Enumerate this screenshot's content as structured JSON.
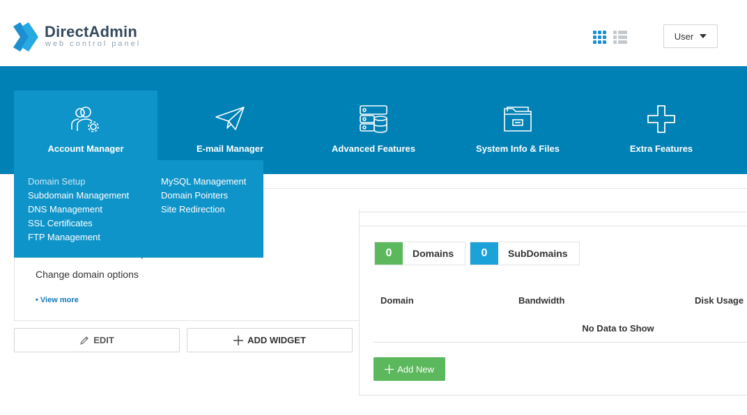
{
  "brand": {
    "name": "DirectAdmin",
    "tagline": "web control panel",
    "primary_color": "#0081b5",
    "active_color": "#0f94c9"
  },
  "header": {
    "user_label": "User",
    "views": [
      "grid-view-icon",
      "list-view-icon"
    ]
  },
  "nav": {
    "items": [
      {
        "label": "Account Manager",
        "icon": "users-gear-icon",
        "active": true
      },
      {
        "label": "E-mail Manager",
        "icon": "paper-plane-icon"
      },
      {
        "label": "Advanced Features",
        "icon": "server-icon"
      },
      {
        "label": "System Info & Files",
        "icon": "folder-icon"
      },
      {
        "label": "Extra Features",
        "icon": "plus-icon"
      }
    ],
    "dropdown": {
      "col1": [
        "Domain Setup",
        "Subdomain Management",
        "DNS Management",
        "SSL Certificates",
        "FTP Management"
      ],
      "col2": [
        "MySQL Management",
        "Domain Pointers",
        "Site Redirection"
      ]
    }
  },
  "widget": {
    "title_fragment": "p",
    "description": "Change domain options",
    "view_more": "• View more"
  },
  "actions": {
    "edit": "EDIT",
    "add_widget": "ADD WIDGET"
  },
  "stats": {
    "domains": {
      "count": "0",
      "label": "Domains",
      "color": "#5cb85c"
    },
    "subdomains": {
      "count": "0",
      "label": "SubDomains",
      "color": "#1ba2d8"
    }
  },
  "table": {
    "columns": [
      "Domain",
      "Bandwidth",
      "Disk Usage"
    ],
    "empty": "No Data to Show"
  },
  "add_new": "Add New"
}
